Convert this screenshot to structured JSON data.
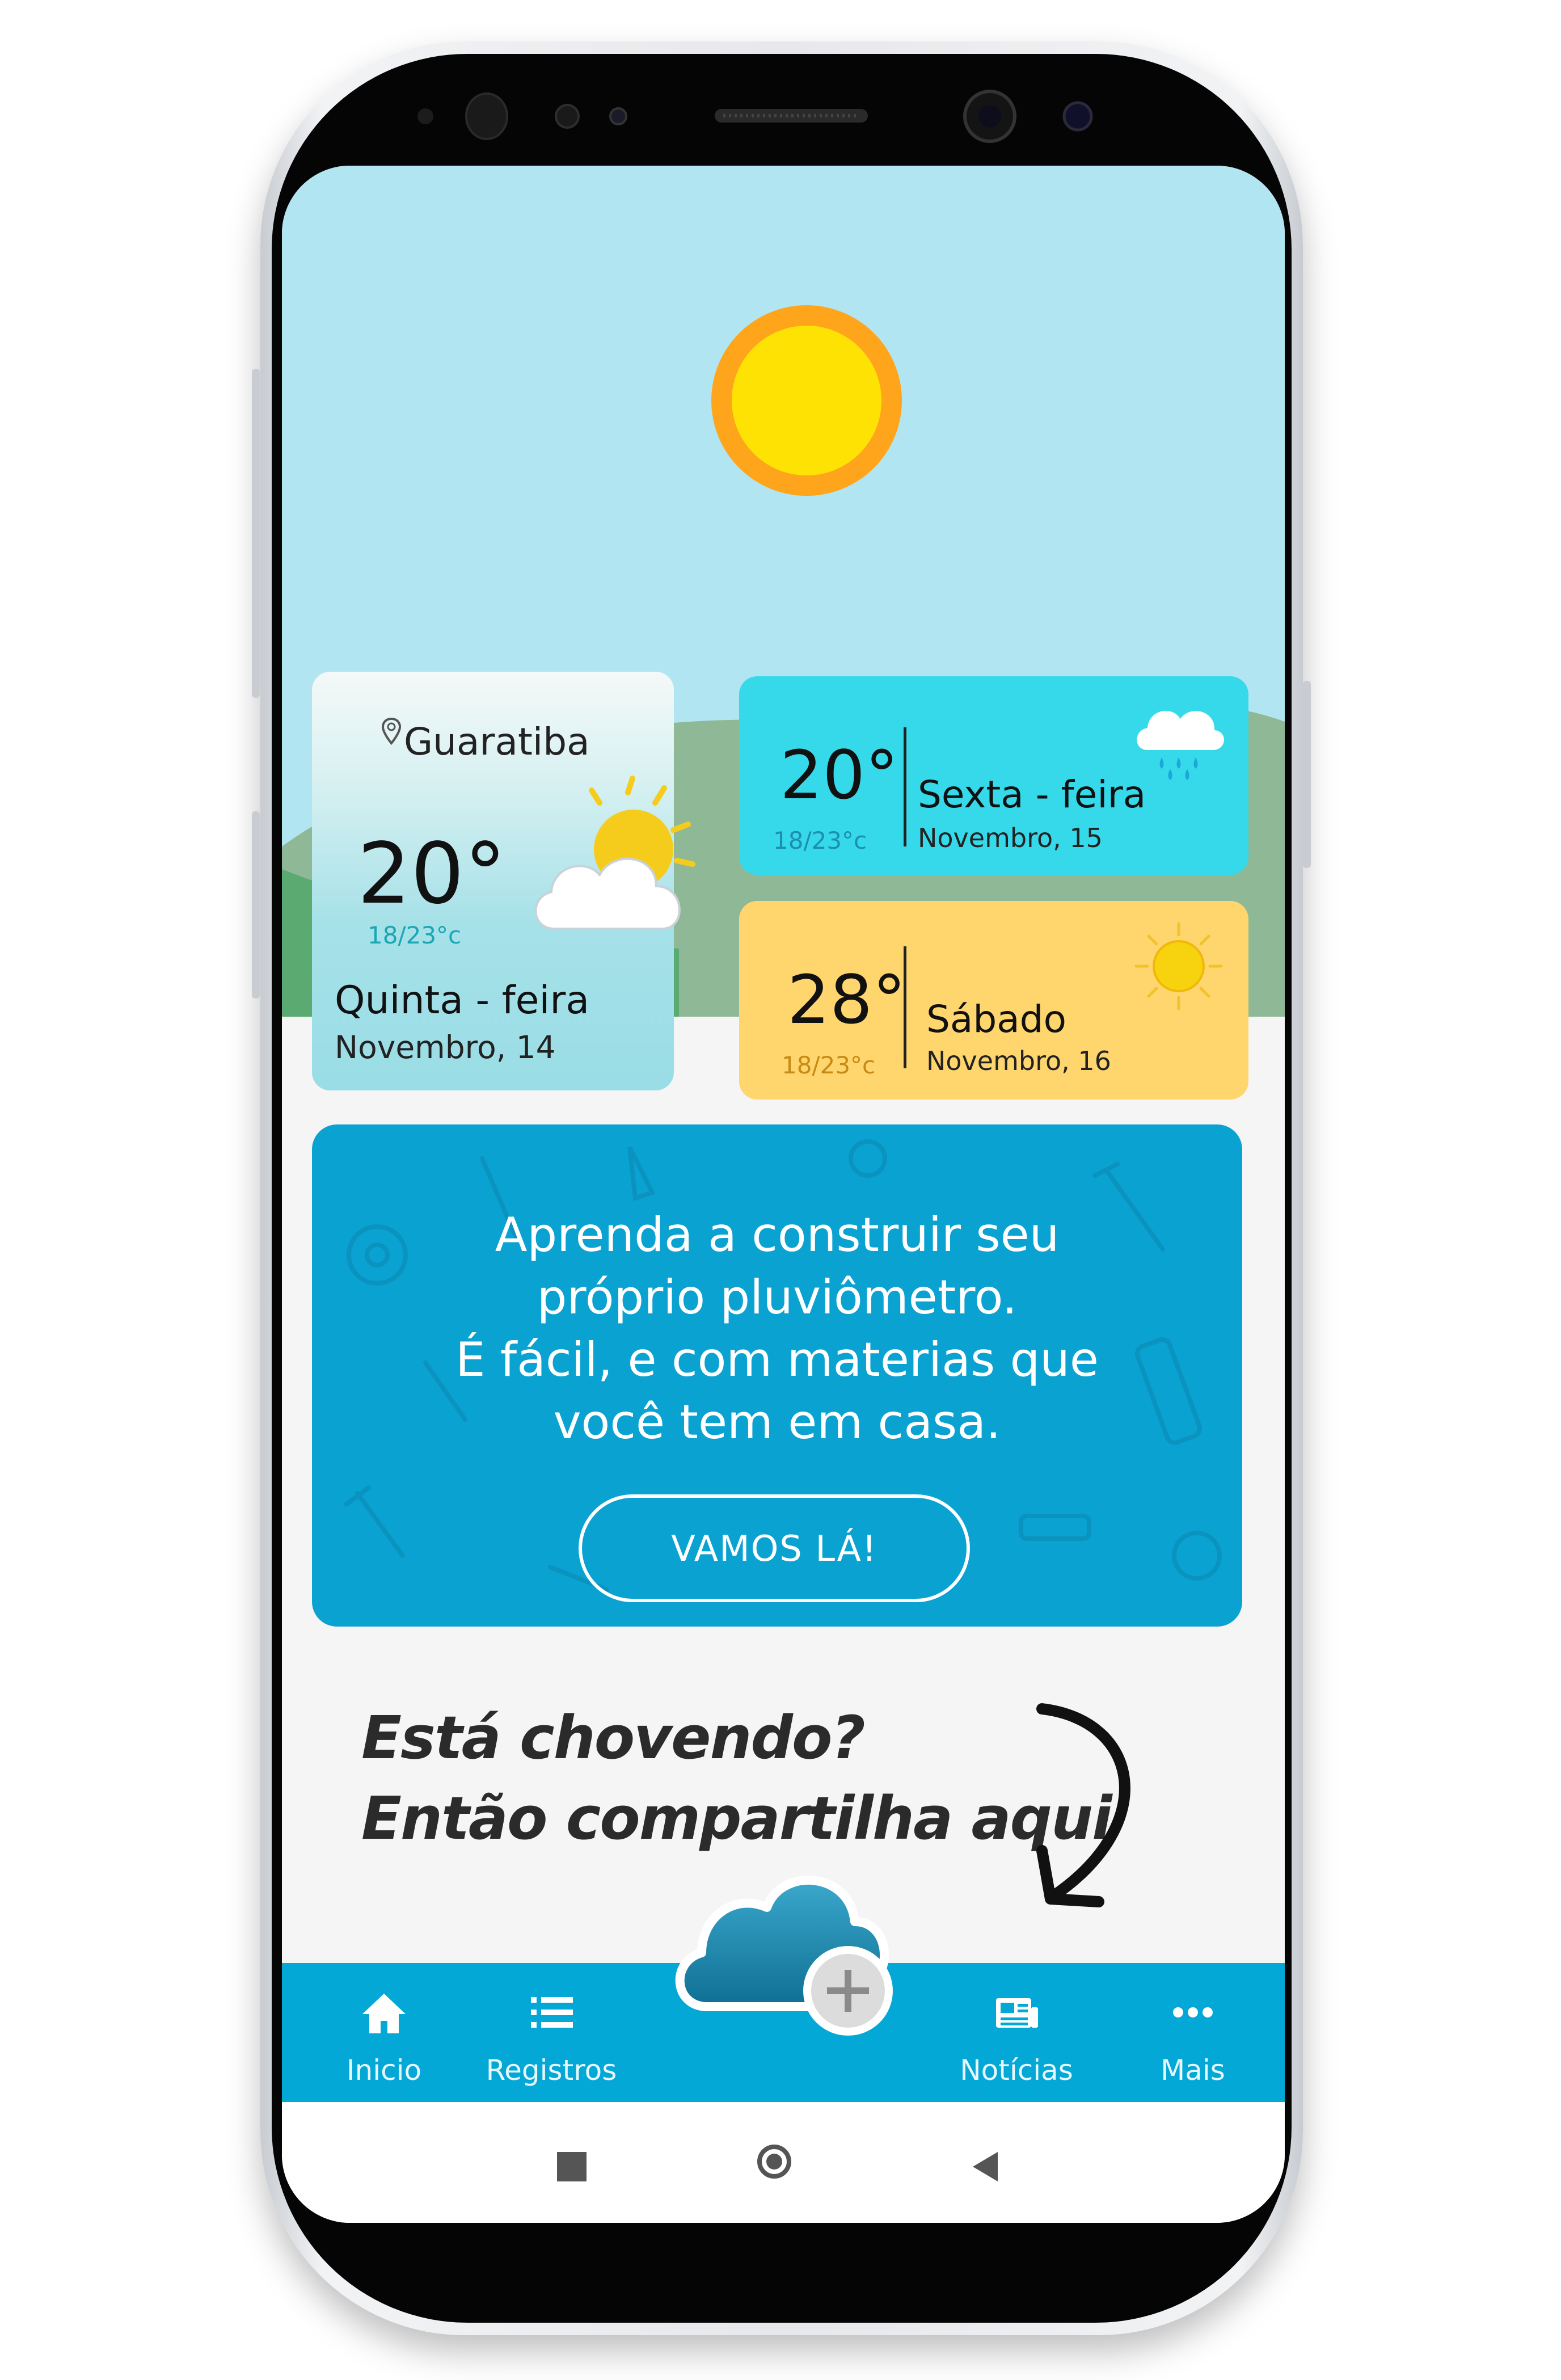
{
  "weather": {
    "today": {
      "location": "Guaratiba",
      "temperature": "20°",
      "range": "18/23°c",
      "day": "Quinta - feira",
      "date": "Novembro, 14",
      "icon": "partly-cloudy-icon"
    },
    "forecast": [
      {
        "temperature": "20°",
        "range": "18/23°c",
        "day": "Sexta - feira",
        "date": "Novembro, 15",
        "icon": "rain-cloud-icon",
        "color": "#36d9ea"
      },
      {
        "temperature": "28°",
        "range": "18/23°c",
        "day": "Sábado",
        "date": "Novembro, 16",
        "icon": "sun-icon",
        "color": "#ffd66e"
      }
    ]
  },
  "promo": {
    "text": "Aprenda a construir seu\npróprio pluviômetro.\nÉ fácil, e com materias que\nvocê tem em casa.",
    "button_label": "VAMOS LÁ!",
    "color": "#0aa2d1"
  },
  "share": {
    "text": "Está chovendo?\nEntão compartilha aqui",
    "button_icon": "cloud-add-icon"
  },
  "bottom_nav": {
    "items": [
      {
        "label": "Inicio",
        "icon": "home-icon"
      },
      {
        "label": "Registros",
        "icon": "list-icon"
      },
      {
        "label": "Notícias",
        "icon": "news-icon"
      },
      {
        "label": "Mais",
        "icon": "more-icon"
      }
    ],
    "color": "#04a8d6"
  },
  "system_nav": {
    "items": [
      {
        "icon": "recents-square-icon"
      },
      {
        "icon": "home-circle-icon"
      },
      {
        "icon": "back-triangle-icon"
      }
    ]
  }
}
